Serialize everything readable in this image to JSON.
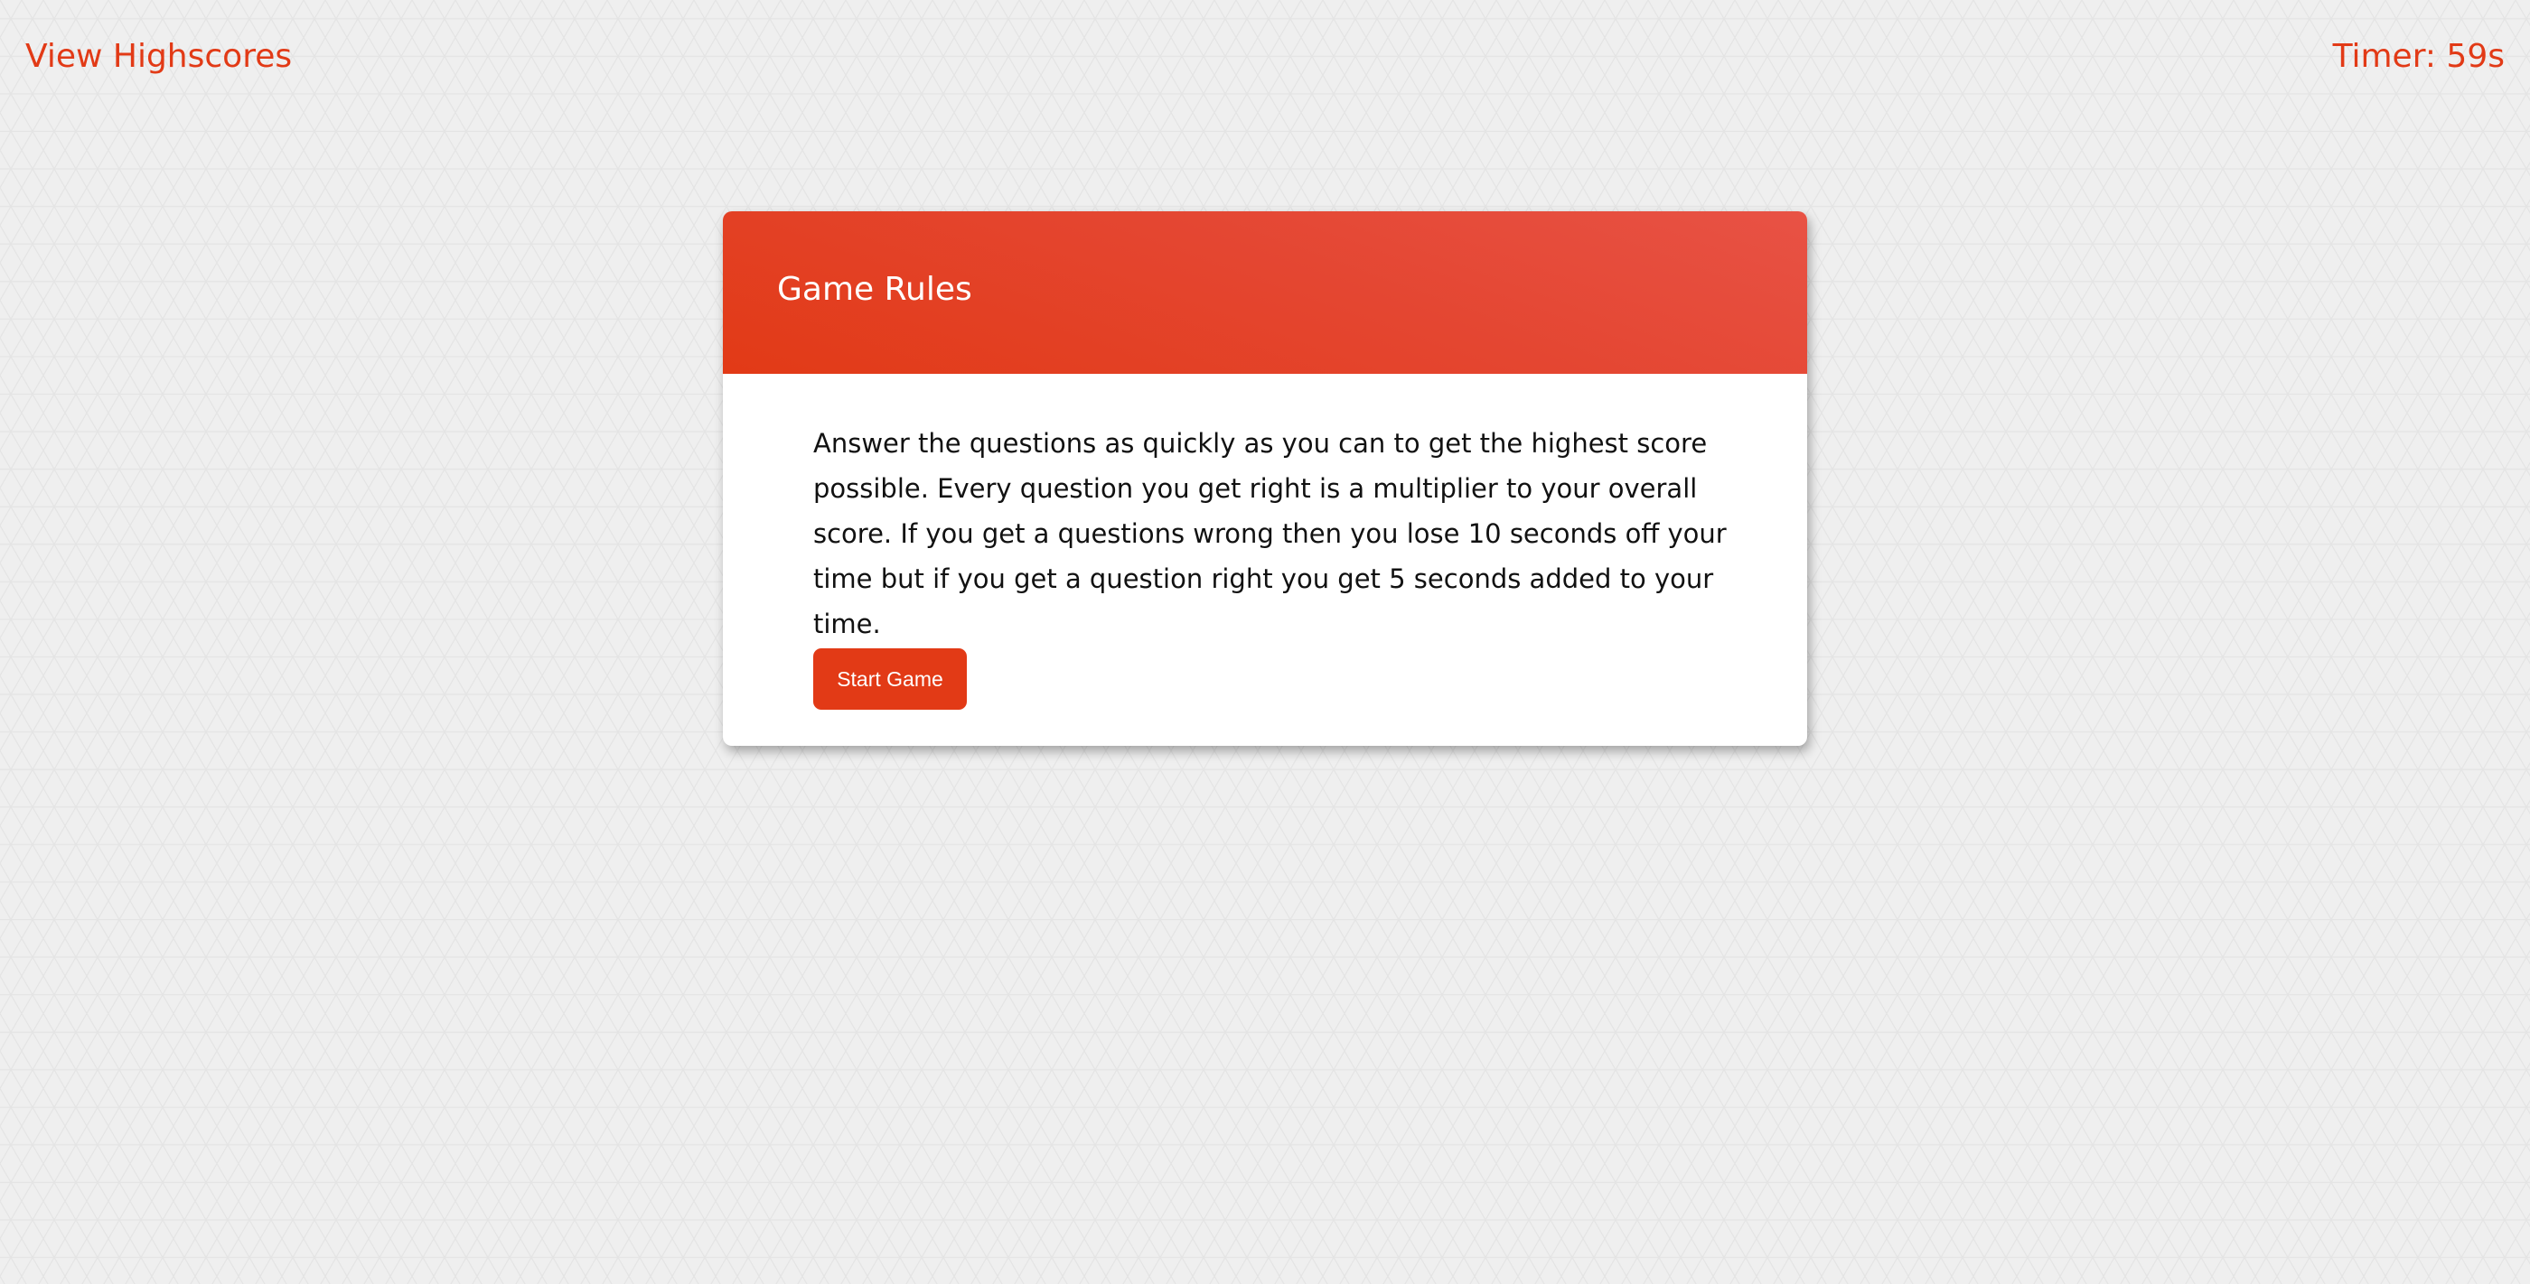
{
  "header": {
    "highscores_label": "View Highscores",
    "timer_label": "Timer: 59s"
  },
  "card": {
    "title": "Game Rules",
    "rules": "Answer the questions as quickly as you can to get the highest score possible. Every question you get right is a multiplier to your overall score. If you get a questions wrong then you lose 10 seconds off your time but if you get a question right you get 5 seconds added to your time.",
    "start_label": "Start Game"
  },
  "colors": {
    "accent": "#e23a16",
    "header_gradient_light": "#e85245",
    "page_background": "#efefef",
    "card_background": "#ffffff"
  }
}
